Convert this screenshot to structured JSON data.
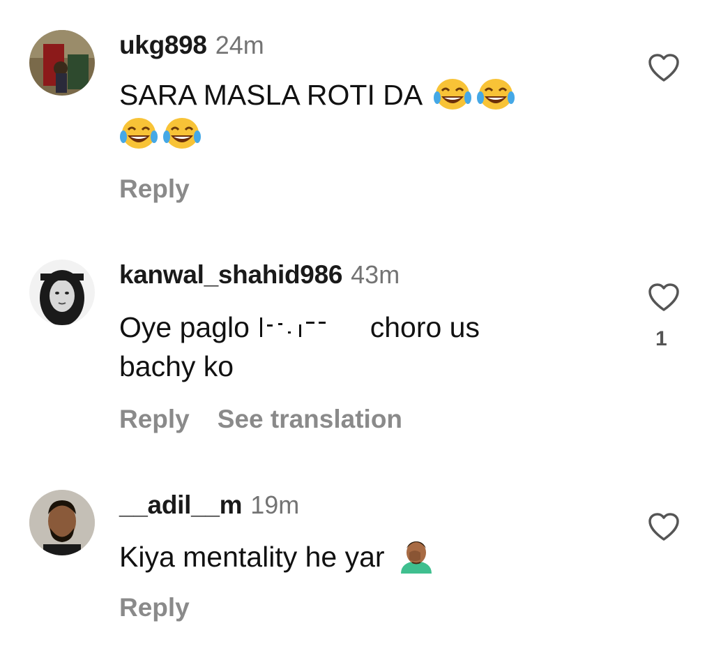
{
  "comments": [
    {
      "username": "ukg898",
      "time": "24m",
      "text": "SARA MASLA ROTI DA",
      "emojis": [
        "tears-of-joy-emoji",
        "tears-of-joy-emoji",
        "tears-of-joy-emoji",
        "tears-of-joy-emoji"
      ],
      "actions": [
        "Reply"
      ],
      "like_count": ""
    },
    {
      "username": "kanwal_shahid986",
      "time": "43m",
      "text_before": "Oye paglo",
      "text_after": "choro us",
      "text_line2": "bachy ko",
      "actions": [
        "Reply",
        "See translation"
      ],
      "like_count": "1"
    },
    {
      "username": "__adil__m",
      "time": "19m",
      "text": "Kiya mentality he yar",
      "emojis": [
        "man-facepalming-emoji"
      ],
      "actions": [
        "Reply"
      ],
      "like_count": ""
    }
  ],
  "icons": {
    "like": "heart-outline-icon"
  },
  "colors": {
    "text": "#111111",
    "muted": "#737373",
    "action": "#8a8a8a"
  }
}
